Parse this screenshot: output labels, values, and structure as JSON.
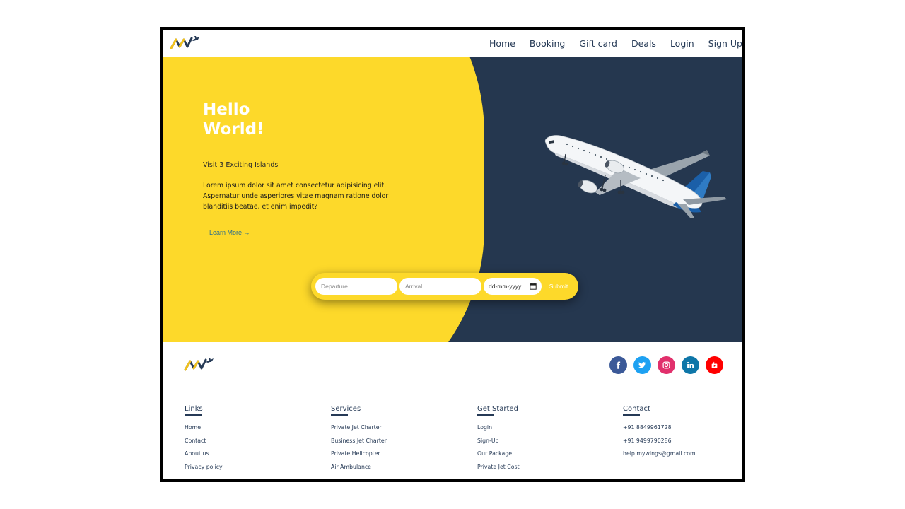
{
  "header": {
    "logo_icon": "mywings-logo-icon",
    "nav": [
      {
        "label": "Home"
      },
      {
        "label": "Booking"
      },
      {
        "label": "Gift card"
      },
      {
        "label": "Deals"
      },
      {
        "label": "Login"
      },
      {
        "label": "Sign Up"
      }
    ]
  },
  "hero": {
    "title_line1": "Hello",
    "title_line2": "World!",
    "subtitle": "Visit 3 Exciting Islands",
    "text": "Lorem ipsum dolor sit amet consectetur adipisicing elit. Aspernatur unde asperiores vitae magnam ratione dolor blanditiis beatae, et enim impedit?",
    "link": "Learn More →",
    "image_icon": "airplane-image"
  },
  "search": {
    "departure_placeholder": "Departure",
    "arrival_placeholder": "Arrival",
    "date_placeholder": "dd-mm-yyyy",
    "submit_label": "Submit"
  },
  "footer": {
    "logo_icon": "mywings-logo-icon",
    "socials": [
      {
        "icon": "facebook-icon",
        "color": "#3b5998"
      },
      {
        "icon": "twitter-icon",
        "color": "#1da1f2"
      },
      {
        "icon": "instagram-icon",
        "color": "#e1306c"
      },
      {
        "icon": "linkedin-icon",
        "color": "#0e76a8"
      },
      {
        "icon": "youtube-icon",
        "color": "#ff0000"
      }
    ],
    "columns": [
      {
        "title": "Links",
        "items": [
          "Home",
          "Contact",
          "About us",
          "Privacy policy"
        ]
      },
      {
        "title": "Services",
        "items": [
          "Private Jet Charter",
          "Business Jet Charter",
          "Private Helicopter",
          "Air Ambulance"
        ]
      },
      {
        "title": "Get Started",
        "items": [
          "Login",
          "Sign-Up",
          "Our Package",
          "Private Jet Cost"
        ]
      },
      {
        "title": "Contact",
        "items": [
          "+91 8849961728",
          "+91 9499790286",
          "help.mywings@gmail.com"
        ]
      }
    ]
  },
  "colors": {
    "accent_yellow": "#fdd92a",
    "navy": "#25374f",
    "text_navy": "#263a56"
  }
}
